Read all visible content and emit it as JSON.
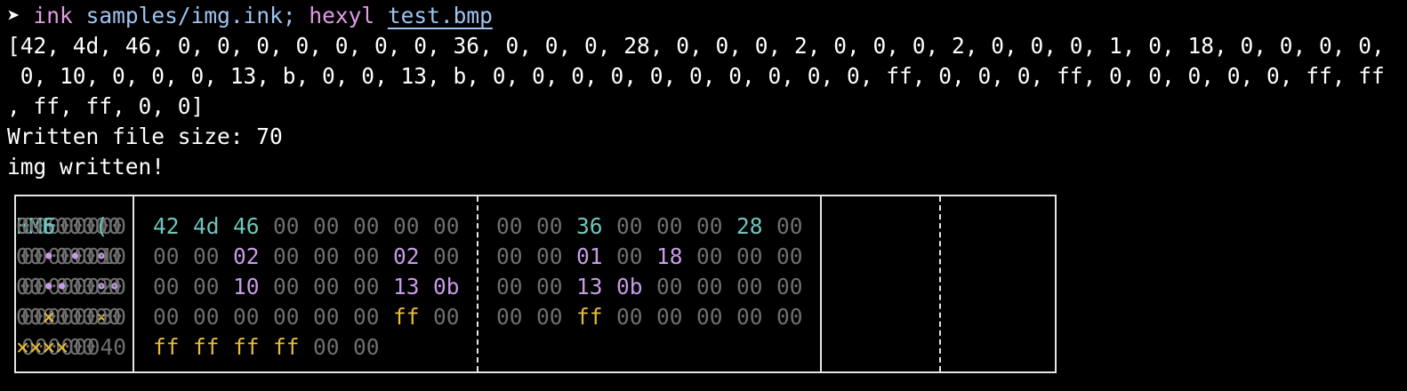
{
  "terminal": {
    "prompt_symbol": "➤",
    "command1": "ink",
    "command1_args": "samples/img.ink;",
    "command2": "hexyl",
    "command2_arg": "test.bmp",
    "output": [
      "[42, 4d, 46, 0, 0, 0, 0, 0, 0, 0, 36, 0, 0, 0, 28, 0, 0, 0, 2, 0, 0, 0, 2, 0, 0, 0, 1, 0, 18, 0, 0, 0, 0,",
      " 0, 10, 0, 0, 0, 13, b, 0, 0, 13, b, 0, 0, 0, 0, 0, 0, 0, 0, 0, 0, ff, 0, 0, 0, ff, 0, 0, 0, 0, 0, ff, ff",
      ", ff, ff, 0, 0]",
      "Written file size: 70",
      "img written!"
    ]
  },
  "hexdump": {
    "rows": [
      {
        "addr": "00000000",
        "hex1": [
          "42",
          "4d",
          "46",
          "00",
          "00",
          "00",
          "00",
          "00"
        ],
        "hex2": [
          "00",
          "00",
          "36",
          "00",
          "00",
          "00",
          "28",
          "00"
        ],
        "ascii1": "BMF00000",
        "ascii2": "006000(0"
      },
      {
        "addr": "00000010",
        "hex1": [
          "00",
          "00",
          "02",
          "00",
          "00",
          "00",
          "02",
          "00"
        ],
        "hex2": [
          "00",
          "00",
          "01",
          "00",
          "18",
          "00",
          "00",
          "00"
        ],
        "ascii1": "00•000•0",
        "ascii2": "00•0•000"
      },
      {
        "addr": "00000020",
        "hex1": [
          "00",
          "00",
          "10",
          "00",
          "00",
          "00",
          "13",
          "0b"
        ],
        "hex2": [
          "00",
          "00",
          "13",
          "0b",
          "00",
          "00",
          "00",
          "00"
        ],
        "ascii1": "00•000••",
        "ascii2": "00••0000"
      },
      {
        "addr": "00000030",
        "hex1": [
          "00",
          "00",
          "00",
          "00",
          "00",
          "00",
          "ff",
          "00"
        ],
        "hex2": [
          "00",
          "00",
          "ff",
          "00",
          "00",
          "00",
          "00",
          "00"
        ],
        "ascii1": "000000×0",
        "ascii2": "00×00000"
      },
      {
        "addr": "00000040",
        "hex1": [
          "ff",
          "ff",
          "ff",
          "ff",
          "00",
          "00"
        ],
        "hex2": [],
        "ascii1": "××××00",
        "ascii2": ""
      }
    ]
  },
  "colors": {
    "background": "#000000",
    "null_byte": "#6f6f6f",
    "printable": "#6fc4bc",
    "whitespace_control": "#c79be6",
    "non_ascii": "#e6bc3c",
    "command": "#e49be9",
    "argument": "#9fc4f0",
    "border": "#e5e5e5"
  }
}
